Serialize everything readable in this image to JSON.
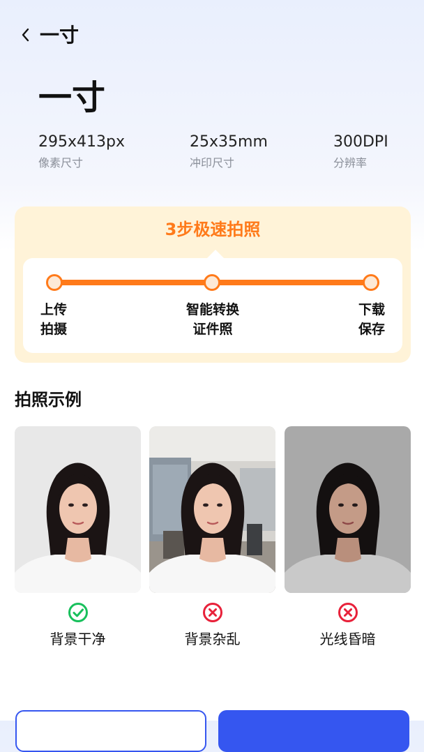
{
  "header": {
    "back_icon": "chevron-left-icon",
    "title": "一寸"
  },
  "main": {
    "big_title": "一寸"
  },
  "specs": [
    {
      "value": "295x413px",
      "label": "像素尺寸"
    },
    {
      "value": "25x35mm",
      "label": "冲印尺寸"
    },
    {
      "value": "300DPI",
      "label": "分辨率"
    }
  ],
  "steps": {
    "title": "3步极速拍照",
    "items": [
      {
        "line1": "上传",
        "line2": "拍摄"
      },
      {
        "line1": "智能转换",
        "line2": "证件照"
      },
      {
        "line1": "下载",
        "line2": "保存"
      }
    ],
    "accent": "#ff7a1a"
  },
  "examples": {
    "title": "拍照示例",
    "items": [
      {
        "label": "背景干净",
        "status": "ok",
        "icon": "check-circle-icon"
      },
      {
        "label": "背景杂乱",
        "status": "bad",
        "icon": "x-circle-icon"
      },
      {
        "label": "光线昏暗",
        "status": "bad",
        "icon": "x-circle-icon"
      }
    ]
  },
  "colors": {
    "primary": "#3556f0",
    "ok": "#18c05c",
    "bad": "#e8213a"
  }
}
